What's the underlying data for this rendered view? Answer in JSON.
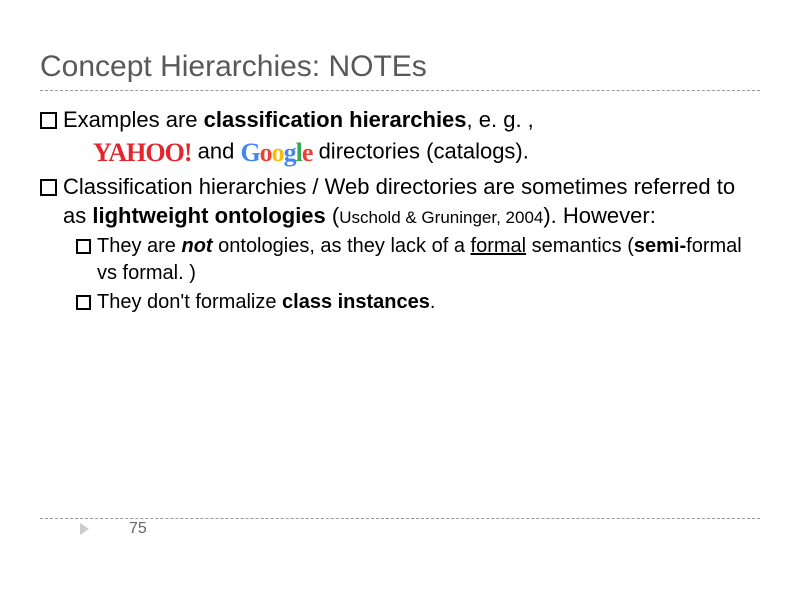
{
  "title": "Concept Hierarchies: NOTEs",
  "bullets": {
    "b1_pre": "Examples are ",
    "b1_bold": "classification hierarchies",
    "b1_post": ", e. g. ,",
    "b1_cont_pre": " and ",
    "b1_cont_post": " directories (catalogs).",
    "b2_pre": "Classification hierarchies /  Web directories are sometimes referred to as ",
    "b2_bold": "lightweight ontologies",
    "b2_post1": " (",
    "b2_cite": "Uschold & Gruninger, 2004",
    "b2_post2": "). However:",
    "b2a_pre": "They are ",
    "b2a_bold1": "not",
    "b2a_mid1": " ontologies, as they lack of a ",
    "b2a_under": "formal",
    "b2a_mid2": " semantics (",
    "b2a_bold2": "semi-",
    "b2a_mid3": "formal vs formal. )",
    "b2b_pre": "They don't formalize ",
    "b2b_bold": "class instances",
    "b2b_post": "."
  },
  "logos": {
    "yahoo": "YAHOO!",
    "google": {
      "g": "G",
      "o1": "o",
      "o2": "o",
      "g2": "g",
      "l": "l",
      "e": "e"
    }
  },
  "page_number": "75"
}
